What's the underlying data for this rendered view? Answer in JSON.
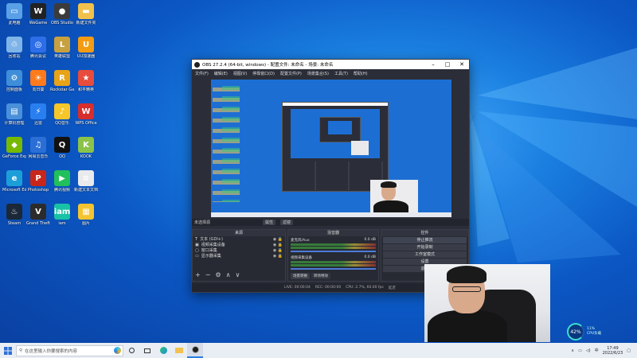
{
  "desktop": {
    "icons": [
      {
        "label": "此电脑",
        "color": "#5aa0e6",
        "glyph": "▭"
      },
      {
        "label": "回收站",
        "color": "#7fb4e8",
        "glyph": "♲"
      },
      {
        "label": "控制面板",
        "color": "#3f8ed8",
        "glyph": "⚙"
      },
      {
        "label": "计算机管理",
        "color": "#4a90d9",
        "glyph": "▤"
      },
      {
        "label": "GeForce Experience",
        "color": "#76b900",
        "glyph": "◆"
      },
      {
        "label": "Microsoft Edge",
        "color": "#1c9fd8",
        "glyph": "e"
      },
      {
        "label": "Steam",
        "color": "#1b2838",
        "glyph": "♨"
      },
      {
        "label": "WeGame",
        "color": "#222",
        "glyph": "W"
      },
      {
        "label": "腾讯会议",
        "color": "#2d6ee8",
        "glyph": "◎"
      },
      {
        "label": "向日葵",
        "color": "#ff7a1a",
        "glyph": "☀"
      },
      {
        "label": "迅雷",
        "color": "#2a7ff0",
        "glyph": "⚡"
      },
      {
        "label": "网易云音乐",
        "color": "#2b6fd6",
        "glyph": "♫"
      },
      {
        "label": "Photoshop",
        "color": "#c8261a",
        "glyph": "P"
      },
      {
        "label": "Grand Theft Auto V",
        "color": "#2b2b2b",
        "glyph": "V"
      },
      {
        "label": "OBS Studio",
        "color": "#3b3b3b",
        "glyph": "●"
      },
      {
        "label": "英雄联盟",
        "color": "#c7a040",
        "glyph": "L"
      },
      {
        "label": "Rockstar Games",
        "color": "#e8a317",
        "glyph": "R"
      },
      {
        "label": "QQ音乐",
        "color": "#f6c62a",
        "glyph": "♪"
      },
      {
        "label": "QQ",
        "color": "#111",
        "glyph": "Q"
      },
      {
        "label": "腾讯视频",
        "color": "#22c05a",
        "glyph": "▶"
      },
      {
        "label": "iam",
        "color": "#18c2a6",
        "glyph": "iam"
      },
      {
        "label": "新建文件夹",
        "color": "#f1c14b",
        "glyph": "▬"
      },
      {
        "label": "UU加速器",
        "color": "#f39c12",
        "glyph": "U"
      },
      {
        "label": "和平精英",
        "color": "#e74c3c",
        "glyph": "★"
      },
      {
        "label": "WPS Office",
        "color": "#d62d2d",
        "glyph": "W"
      },
      {
        "label": "KOOK",
        "color": "#8bc34a",
        "glyph": "K"
      },
      {
        "label": "新建文本文档",
        "color": "#e8eaec",
        "glyph": "≡"
      },
      {
        "label": "图片",
        "color": "#f4c430",
        "glyph": "▦"
      }
    ]
  },
  "obs": {
    "title": "OBS 27.2.4 (64-bit, windows) - 配置文件: 未命名 - 场景: 未命名",
    "menu": [
      "文件(F)",
      "编辑(E)",
      "视图(V)",
      "停靠窗口(D)",
      "配置文件(P)",
      "场景集合(S)",
      "工具(T)",
      "帮助(H)"
    ],
    "scene_bar": {
      "label": "未选择源",
      "props": "属性",
      "filters": "滤镜"
    },
    "sources": {
      "header": "来源",
      "items": [
        "文本 (GDI+)",
        "视频采集设备",
        "窗口采集",
        "显示器采集"
      ]
    },
    "mixer": {
      "header": "混音器",
      "channels": [
        {
          "name": "麦克风/Aux",
          "db": "0.0 dB"
        },
        {
          "name": "视频采集设备",
          "db": "0.0 dB"
        }
      ]
    },
    "controls": {
      "header": "控件",
      "buttons": [
        "停止推流",
        "开始录制",
        "工作室模式",
        "设置",
        "退出"
      ]
    },
    "bottom_tabs": [
      "场景转换",
      "转场特效"
    ],
    "status": {
      "live": "LIVE: 00:00:04",
      "rec": "REC: 00:00:00",
      "cpu": "CPU: 2.7%, 60.00 fps",
      "kbps": "延迟"
    }
  },
  "cpu_widget": {
    "percent": "42%",
    "line1": "11%",
    "line2": "CPU负载"
  },
  "taskbar": {
    "search_placeholder": "在这里输入你要搜索的内容",
    "time": "17:49",
    "date": "2022/6/23",
    "lang": "中"
  }
}
